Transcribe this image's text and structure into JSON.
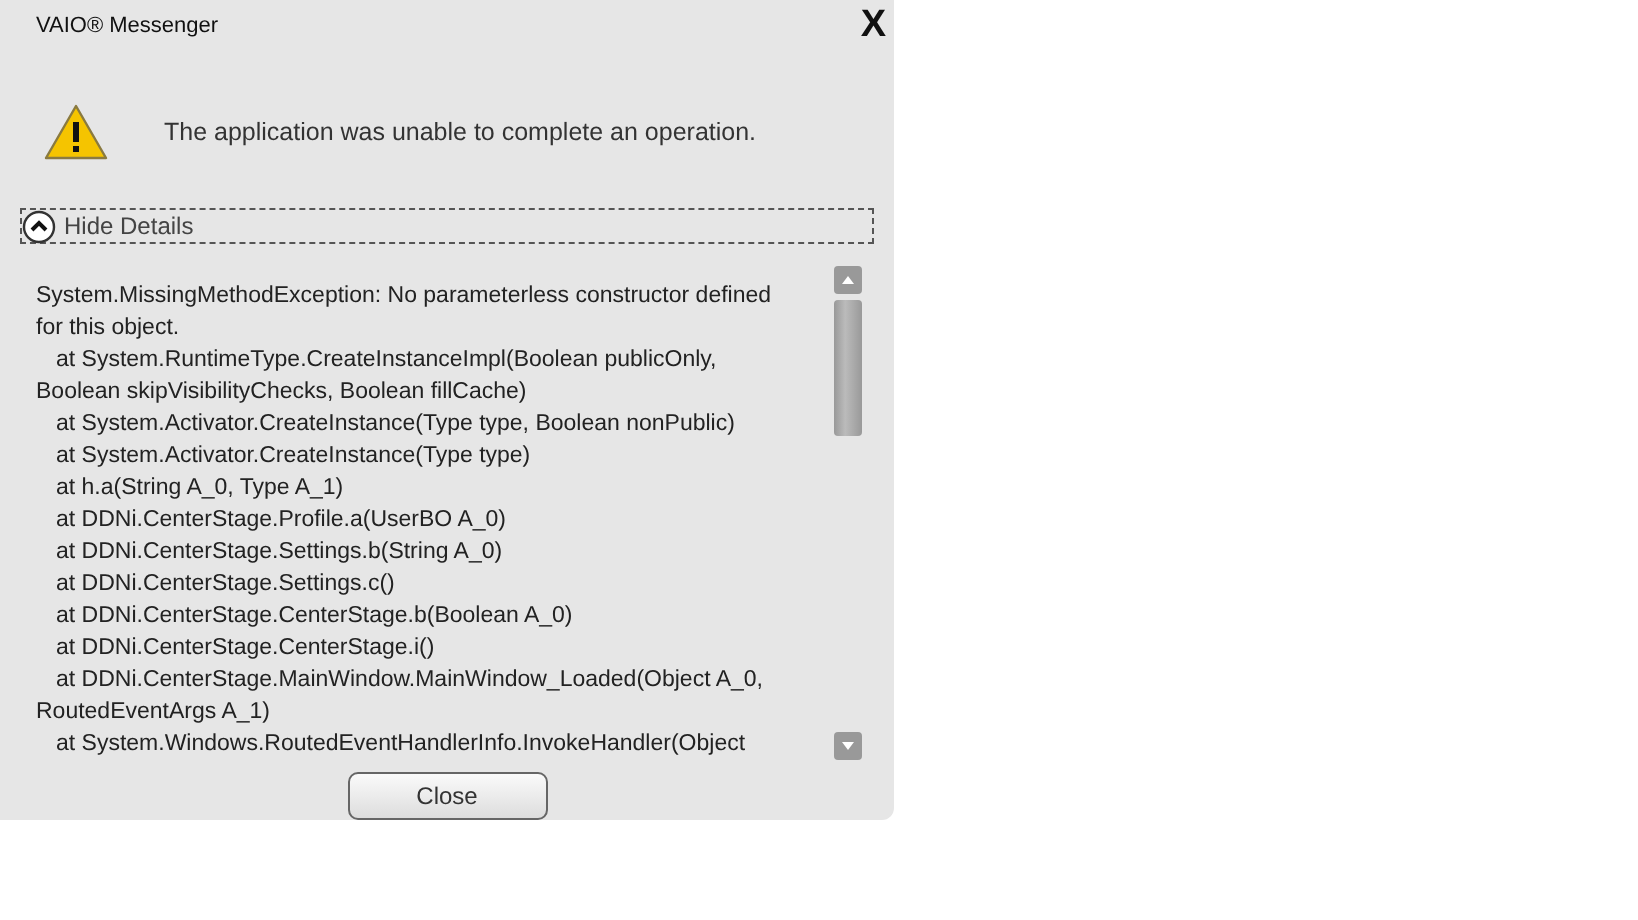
{
  "window": {
    "title": "VAIO® Messenger",
    "close": "X"
  },
  "message": "The application was unable to complete an operation.",
  "details_toggle": {
    "label": "Hide Details",
    "expanded": true
  },
  "details": [
    {
      "kind": "head",
      "text": "System.MissingMethodException: No parameterless constructor defined"
    },
    {
      "kind": "head",
      "text": "for this object."
    },
    {
      "kind": "frame",
      "text": "at System.RuntimeType.CreateInstanceImpl(Boolean publicOnly,"
    },
    {
      "kind": "head",
      "text": "Boolean skipVisibilityChecks, Boolean fillCache)"
    },
    {
      "kind": "frame",
      "text": "at System.Activator.CreateInstance(Type type, Boolean nonPublic)"
    },
    {
      "kind": "frame",
      "text": "at System.Activator.CreateInstance(Type type)"
    },
    {
      "kind": "frame",
      "text": "at h.a(String A_0, Type A_1)"
    },
    {
      "kind": "frame",
      "text": "at DDNi.CenterStage.Profile.a(UserBO A_0)"
    },
    {
      "kind": "frame",
      "text": "at DDNi.CenterStage.Settings.b(String A_0)"
    },
    {
      "kind": "frame",
      "text": "at DDNi.CenterStage.Settings.c()"
    },
    {
      "kind": "frame",
      "text": "at DDNi.CenterStage.CenterStage.b(Boolean A_0)"
    },
    {
      "kind": "frame",
      "text": "at DDNi.CenterStage.CenterStage.i()"
    },
    {
      "kind": "frame",
      "text": "at DDNi.CenterStage.MainWindow.MainWindow_Loaded(Object A_0,"
    },
    {
      "kind": "head",
      "text": "RoutedEventArgs A_1)"
    },
    {
      "kind": "frame",
      "text": "at System.Windows.RoutedEventHandlerInfo.InvokeHandler(Object"
    }
  ],
  "buttons": [
    "Close"
  ]
}
